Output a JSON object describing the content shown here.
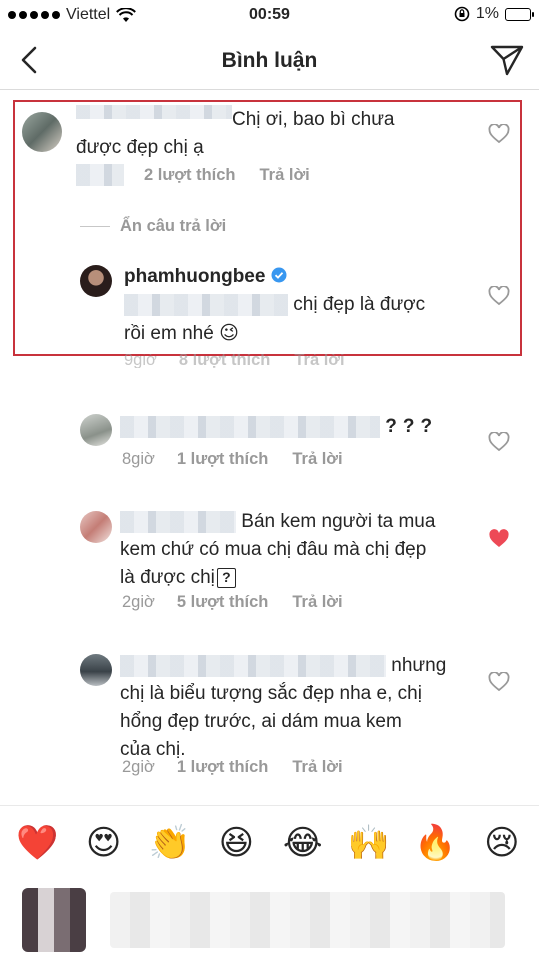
{
  "status_bar": {
    "carrier": "Viettel",
    "time": "00:59",
    "battery": "1%"
  },
  "nav": {
    "title": "Bình luận"
  },
  "comments": [
    {
      "text_line1": "Chị ơi, bao bì chưa",
      "text_line2": "được đẹp chị ạ",
      "likes": "2 lượt thích",
      "reply": "Trả lời"
    },
    {
      "username": "phamhuongbee",
      "text_line1": "chị đẹp là được",
      "text_line2": "rồi em nhé",
      "emoji": "😉",
      "time": "9giờ",
      "likes": "8 lượt thích",
      "reply": "Trả lời"
    },
    {
      "marks": "???",
      "time": "8giờ",
      "likes": "1 lượt thích",
      "reply": "Trả lời"
    },
    {
      "text_line1": "Bán kem người ta mua",
      "text_line2": "kem chứ có mua chị đâu mà chị đẹp",
      "text_line3": "là được chị",
      "mark": "?",
      "time": "2giờ",
      "likes": "5 lượt thích",
      "reply": "Trả lời",
      "liked": true
    },
    {
      "text_line1": "nhưng",
      "text_line2": "chị là biểu tượng sắc đẹp nha e, chị",
      "text_line3": "hổng đẹp trước, ai dám mua kem",
      "text_line4": "của chị.",
      "time": "2giờ",
      "likes": "1 lượt thích",
      "reply": "Trả lời"
    }
  ],
  "hide_replies": "Ẩn câu trả lời",
  "emoji_bar": [
    "❤️",
    "😍",
    "👏",
    "😆",
    "😂",
    "🙌",
    "🔥",
    "😢"
  ],
  "colors": {
    "highlight": "#c8323c",
    "heart_liked": "#ed4956",
    "verified": "#3897f0"
  }
}
